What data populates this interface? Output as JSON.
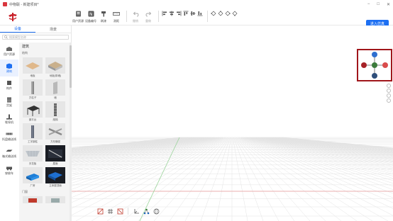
{
  "window": {
    "title": "中物联 - 新建项目*"
  },
  "toolbar": {
    "buttons": [
      {
        "label": "用户资源",
        "icon": "user-resource-icon"
      },
      {
        "label": "设备编号",
        "icon": "device-number-icon"
      },
      {
        "label": "刷漆",
        "icon": "paint-brush-icon"
      },
      {
        "label": "测距",
        "icon": "ruler-icon"
      }
    ],
    "history": [
      {
        "label": "撤销",
        "icon": "undo-icon"
      },
      {
        "label": "重做",
        "icon": "redo-icon"
      }
    ],
    "simulate_label": "进入仿真"
  },
  "left_panel": {
    "tabs": [
      "设备",
      "场景"
    ],
    "active_tab": 0,
    "search_placeholder": "搜索模型名称",
    "categories": [
      {
        "label": "用户资源",
        "icon": "user-resource-icon"
      },
      {
        "label": "建筑",
        "icon": "building-icon"
      },
      {
        "label": "构件",
        "icon": "component-icon"
      },
      {
        "label": "货架",
        "icon": "shelf-icon"
      },
      {
        "label": "堆垛机",
        "icon": "stacker-icon"
      },
      {
        "label": "托盘输送线",
        "icon": "pallet-conveyor-icon"
      },
      {
        "label": "箱式输送线",
        "icon": "box-conveyor-icon"
      },
      {
        "label": "穿梭车",
        "icon": "shuttle-icon"
      }
    ],
    "active_category": 1,
    "library": {
      "title": "建筑",
      "section1": "结构",
      "items": [
        {
          "label": "地板"
        },
        {
          "label": "地板(带墙)"
        },
        {
          "label": "方柱子"
        },
        {
          "label": "墙"
        },
        {
          "label": "钢平台"
        },
        {
          "label": "爬梯"
        },
        {
          "label": "工字钢柱"
        },
        {
          "label": "方形横梁"
        },
        {
          "label": "天花板"
        },
        {
          "label": "屋面"
        },
        {
          "label": "厂房"
        },
        {
          "label": "立体屋顶面"
        }
      ],
      "section2": "门窗"
    }
  },
  "colors": {
    "accent": "#1d6ff2",
    "highlight_border": "#a0161b",
    "compass_top": "#2f6fd0",
    "compass_bottom": "#2e4e7a",
    "compass_left": "#a62227",
    "compass_right": "#d94c4c",
    "compass_center": "#3b7a3b"
  }
}
